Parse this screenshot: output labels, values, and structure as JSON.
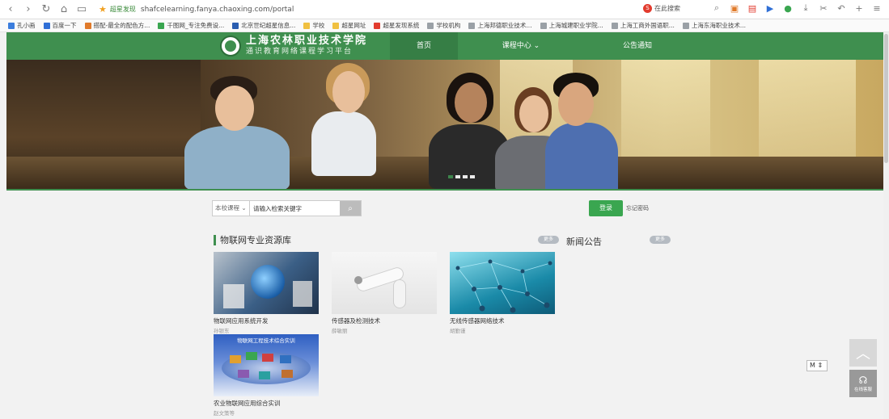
{
  "browser": {
    "url": "shafcelearning.fanya.chaoxing.com/portal",
    "site_tag": "超星发现",
    "search_placeholder": "在此搜索",
    "search_badge": "S"
  },
  "bookmarks": [
    {
      "label": "孔小画",
      "color": "#3b7ddd"
    },
    {
      "label": "百度一下",
      "color": "#2f6fd6"
    },
    {
      "label": "搭配-最全的配色方...",
      "color": "#e07a2a"
    },
    {
      "label": "千图网_专注免费设...",
      "color": "#3aa650"
    },
    {
      "label": "北京世纪超星信息...",
      "color": "#2a5db0"
    },
    {
      "label": "学校",
      "color": "#f0c040"
    },
    {
      "label": "超星网址",
      "color": "#f0c040"
    },
    {
      "label": "超星发现系统",
      "color": "#e23b2e"
    },
    {
      "label": "学校机构",
      "color": "#9aa0a6"
    },
    {
      "label": "上海邦德职业技术...",
      "color": "#9aa0a6"
    },
    {
      "label": "上海城建职业学院...",
      "color": "#9aa0a6"
    },
    {
      "label": "上海工商外国语职...",
      "color": "#9aa0a6"
    },
    {
      "label": "上海东海职业技术...",
      "color": "#9aa0a6"
    }
  ],
  "header": {
    "school_name": "上海农林职业技术学院",
    "platform_name": "通识教育网络课程学习平台",
    "nav": {
      "home": "首页",
      "courses": "课程中心 ⌄",
      "notice": "公告通知"
    }
  },
  "search": {
    "scope": "本校课程 ⌄",
    "placeholder": "请输入检索关键字",
    "login": "登录",
    "forgot": "忘记密码"
  },
  "sections": {
    "resources_title": "物联网专业资源库",
    "news_title": "新闻公告",
    "more": "更多"
  },
  "courses": [
    {
      "name": "物联网应用系统开发",
      "teacher": "孙银东"
    },
    {
      "name": "传感器及检测技术",
      "teacher": "薛敏丽"
    },
    {
      "name": "无线传感器网络技术",
      "teacher": "胡勤谨"
    },
    {
      "name": "农业物联网应用综合实训",
      "teacher": "赵文策等",
      "thumb_text": "物联网工程技术综合实训"
    }
  ],
  "widgets": {
    "select_value": "M ⇕",
    "online_service": "在线客服"
  },
  "colors": {
    "brand_green": "#3f8f4f",
    "login_green": "#3aa650"
  }
}
